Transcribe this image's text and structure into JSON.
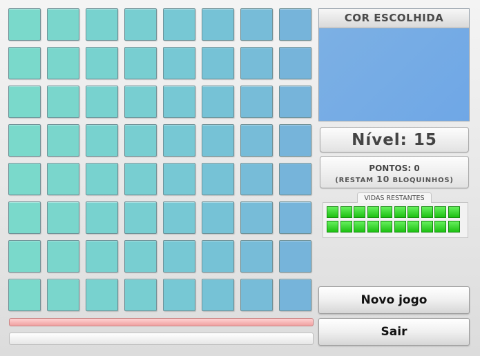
{
  "board": {
    "rows": 8,
    "cols": 8,
    "column_colors": [
      "#7ad9cb",
      "#7ad6cc",
      "#78d2cf",
      "#78ced1",
      "#77c8d4",
      "#76c2d6",
      "#77bcd8",
      "#76b4da"
    ]
  },
  "chosen_color": {
    "title": "COR ESCOLHIDA",
    "color": "#7cb0e4"
  },
  "level": {
    "text": "Nível: 15"
  },
  "points": {
    "label": "PONTOS:",
    "value": "0",
    "remaining_prefix": "(RESTAM",
    "remaining_count": "10",
    "remaining_suffix": "BLOQUINHOS)"
  },
  "lives": {
    "label": "VIDAS RESTANTES",
    "count": 20,
    "color": "#2fd426"
  },
  "buttons": {
    "new_game": "Novo jogo",
    "exit": "Sair"
  },
  "colors": {
    "timer_bar": "#f4b4b4"
  }
}
